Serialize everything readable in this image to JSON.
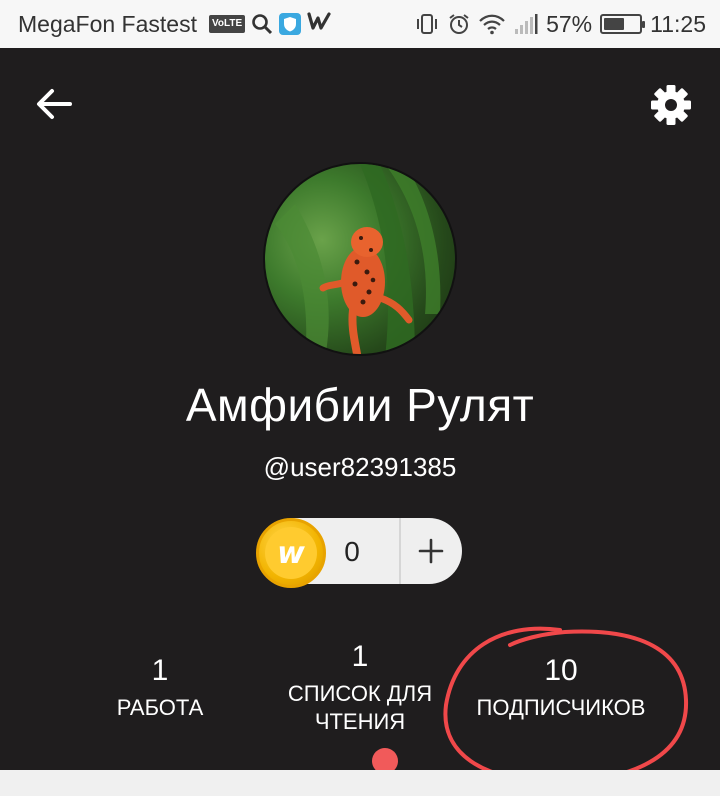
{
  "status_bar": {
    "carrier": "MegaFon Fastest",
    "volte": "VoLTE",
    "battery_percent": "57%",
    "battery_level": 0.57,
    "time": "11:25"
  },
  "header": {
    "back_icon": "arrow-back-icon",
    "settings_icon": "gear-icon"
  },
  "profile": {
    "display_name": "Амфибии Рулят",
    "username": "@user82391385",
    "avatar": "frog-avatar"
  },
  "coins": {
    "count": "0",
    "coin_letter": "w",
    "add_label": "+"
  },
  "stats": {
    "works": {
      "count": "1",
      "label": "РАБОТА"
    },
    "reading_lists": {
      "count": "1",
      "label_line1": "СПИСОК ДЛЯ",
      "label_line2": "ЧТЕНИЯ"
    },
    "followers": {
      "count": "10",
      "label": "ПОДПИСЧИКОВ"
    }
  },
  "colors": {
    "background": "#1f1d1e",
    "coin": "#f2b400",
    "annotation": "#f0484a",
    "dot": "#f15a5a"
  }
}
